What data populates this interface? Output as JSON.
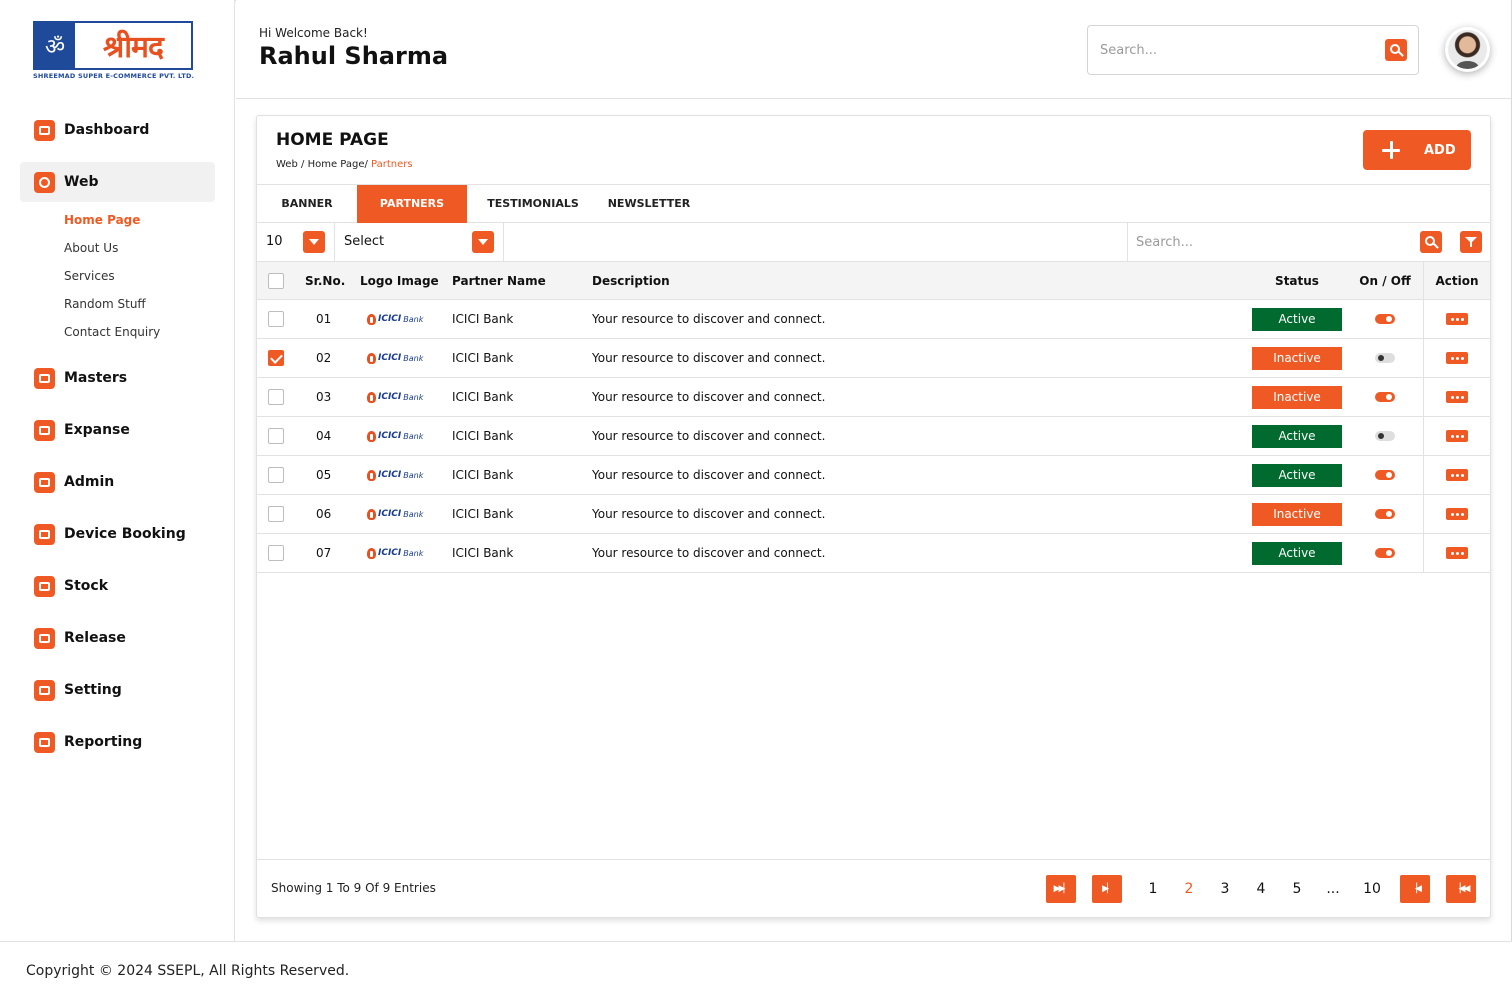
{
  "brand": {
    "logo_word": "श्रीमद",
    "logo_sub": "SHREEMAD SUPER E-COMMERCE PVT. LTD.",
    "accent": "#ef5a24",
    "blue": "#1f4a9a",
    "active_green": "#016b2f"
  },
  "sidebar": {
    "items": [
      {
        "label": "Dashboard",
        "icon": "dashboard-icon"
      },
      {
        "label": "Web",
        "icon": "globe-icon",
        "active": true,
        "children": [
          {
            "label": "Home Page",
            "active": true
          },
          {
            "label": "About Us"
          },
          {
            "label": "Services"
          },
          {
            "label": "Random Stuff"
          },
          {
            "label": "Contact Enquiry"
          }
        ]
      },
      {
        "label": "Masters",
        "icon": "masters-icon"
      },
      {
        "label": "Expanse",
        "icon": "expanse-icon"
      },
      {
        "label": "Admin",
        "icon": "admin-icon"
      },
      {
        "label": "Device Booking",
        "icon": "device-booking-icon"
      },
      {
        "label": "Stock",
        "icon": "stock-icon"
      },
      {
        "label": "Release",
        "icon": "release-icon"
      },
      {
        "label": "Setting",
        "icon": "setting-icon"
      },
      {
        "label": "Reporting",
        "icon": "reporting-icon"
      }
    ]
  },
  "header": {
    "welcome": "Hi Welcome Back!",
    "username": "Rahul Sharma",
    "search_placeholder": "Search..."
  },
  "page": {
    "title": "HOME PAGE",
    "breadcrumb": [
      "Web",
      "Home Page/",
      "Partners"
    ],
    "add_label": "ADD",
    "tabs": [
      {
        "label": "BANNER"
      },
      {
        "label": "PARTNERS",
        "active": true
      },
      {
        "label": "TESTIMONIALS"
      },
      {
        "label": "NEWSLETTER"
      }
    ],
    "filters": {
      "page_size": "10",
      "select": "Select",
      "search_placeholder": "Search..."
    }
  },
  "table": {
    "columns": [
      "Sr.No.",
      "Logo Image",
      "Partner Name",
      "Description",
      "Status",
      "On / Off",
      "Action"
    ],
    "logo_text": "ICICI",
    "logo_bank": "Bank",
    "rows": [
      {
        "sr": "01",
        "name": "ICICI Bank",
        "desc": "Your resource to discover and connect.",
        "status": "Active",
        "on": true,
        "checked": false
      },
      {
        "sr": "02",
        "name": "ICICI Bank",
        "desc": "Your resource to discover and connect.",
        "status": "Inactive",
        "on": false,
        "checked": true
      },
      {
        "sr": "03",
        "name": "ICICI Bank",
        "desc": "Your resource to discover and connect.",
        "status": "Inactive",
        "on": true,
        "checked": false
      },
      {
        "sr": "04",
        "name": "ICICI Bank",
        "desc": "Your resource to discover and connect.",
        "status": "Active",
        "on": false,
        "checked": false
      },
      {
        "sr": "05",
        "name": "ICICI Bank",
        "desc": "Your resource to discover and connect.",
        "status": "Active",
        "on": true,
        "checked": false
      },
      {
        "sr": "06",
        "name": "ICICI Bank",
        "desc": "Your resource to discover and connect.",
        "status": "Inactive",
        "on": true,
        "checked": false
      },
      {
        "sr": "07",
        "name": "ICICI Bank",
        "desc": "Your resource to discover and connect.",
        "status": "Active",
        "on": true,
        "checked": false
      }
    ]
  },
  "pagination": {
    "showing": "Showing 1 To 9 Of 9 Entries",
    "pages": [
      "1",
      "2",
      "3",
      "4",
      "5",
      "...",
      "10"
    ],
    "current": "2"
  },
  "footer": {
    "copyright": "Copyright © 2024 SSEPL, All Rights Reserved."
  }
}
